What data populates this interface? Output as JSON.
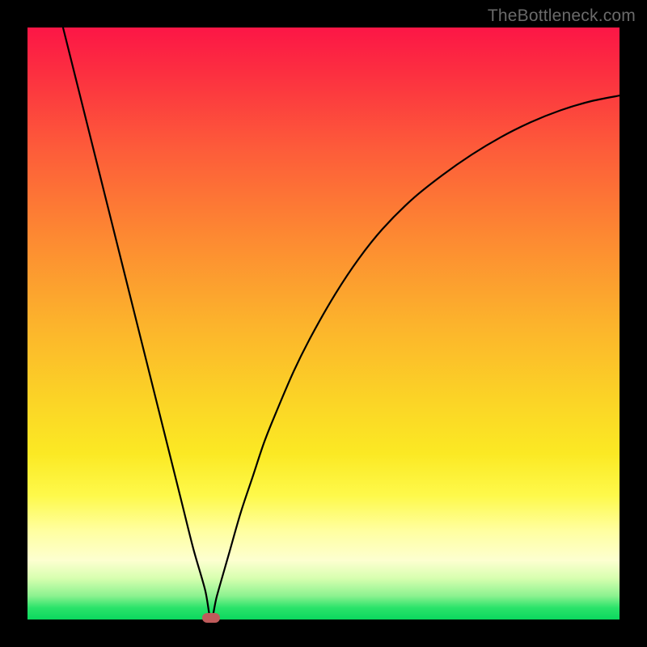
{
  "watermark": "TheBottleneck.com",
  "chart_data": {
    "type": "line",
    "title": "",
    "xlabel": "",
    "ylabel": "",
    "xlim": [
      0,
      100
    ],
    "ylim": [
      0,
      100
    ],
    "grid": false,
    "legend": false,
    "series": [
      {
        "name": "curve",
        "x": [
          6,
          8,
          10,
          12,
          14,
          16,
          18,
          20,
          22,
          24,
          26,
          28,
          30,
          31,
          32,
          34,
          36,
          38,
          40,
          42,
          45,
          48,
          52,
          56,
          60,
          65,
          70,
          75,
          80,
          85,
          90,
          95,
          100
        ],
        "values": [
          100,
          92,
          84,
          76,
          68,
          60,
          52,
          44,
          36,
          28,
          20,
          12,
          5,
          0,
          4,
          11,
          18,
          24,
          30,
          35,
          42,
          48,
          55,
          61,
          66,
          71,
          75,
          78.5,
          81.5,
          84,
          86,
          87.5,
          88.5
        ]
      }
    ],
    "marker": {
      "x": 31,
      "y": 0,
      "shape": "rounded-rect",
      "color": "#c05b5b"
    },
    "colors": {
      "curve": "#000000",
      "background_gradient": [
        "#fc1646",
        "#fd8832",
        "#fbe924",
        "#0bd85e"
      ]
    }
  }
}
